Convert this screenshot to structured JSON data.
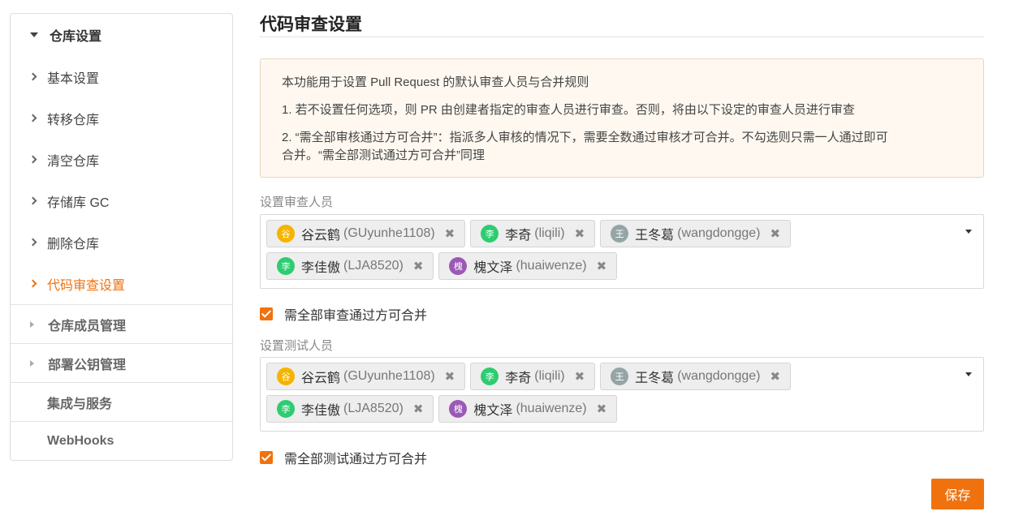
{
  "sidebar": {
    "group_label": "仓库设置",
    "items": [
      {
        "label": "基本设置",
        "active": false
      },
      {
        "label": "转移仓库",
        "active": false
      },
      {
        "label": "清空仓库",
        "active": false
      },
      {
        "label": "存储库 GC",
        "active": false
      },
      {
        "label": "删除仓库",
        "active": false
      },
      {
        "label": "代码审查设置",
        "active": true
      }
    ],
    "sections": [
      {
        "label": "仓库成员管理"
      },
      {
        "label": "部署公钥管理"
      },
      {
        "label": "集成与服务"
      },
      {
        "label": "WebHooks"
      }
    ]
  },
  "page_title": "代码审查设置",
  "notice": {
    "line1": "本功能用于设置 Pull Request 的默认审查人员与合并规则",
    "line2": "1. 若不设置任何选项，则 PR 由创建者指定的审查人员进行审查。否则，将由以下设定的审查人员进行审查",
    "line3a": "2. “需全部审核通过方可合并”：指派多人审核的情况下，需要全数通过审核才可合并。不勾选则只需一人通过即可",
    "line3b": "合并。“需全部测试通过方可合并”同理"
  },
  "reviewers": {
    "label": "设置审查人员",
    "users": [
      {
        "avatar_char": "谷",
        "avatar_color": "#f5b400",
        "name": "谷云鹤",
        "username": "(GUyunhe1108)"
      },
      {
        "avatar_char": "李",
        "avatar_color": "#2ecc71",
        "name": "李奇",
        "username": "(liqili)"
      },
      {
        "avatar_char": "王",
        "avatar_color": "#95a5a6",
        "name": "王冬葛",
        "username": "(wangdongge)"
      },
      {
        "avatar_char": "李",
        "avatar_color": "#2ecc71",
        "name": "李佳傲",
        "username": "(LJA8520)"
      },
      {
        "avatar_char": "槐",
        "avatar_color": "#9b59b6",
        "name": "槐文泽",
        "username": "(huaiwenze)"
      }
    ],
    "checkbox_label": "需全部审查通过方可合并",
    "checked": true
  },
  "testers": {
    "label": "设置测试人员",
    "users": [
      {
        "avatar_char": "谷",
        "avatar_color": "#f5b400",
        "name": "谷云鹤",
        "username": "(GUyunhe1108)"
      },
      {
        "avatar_char": "李",
        "avatar_color": "#2ecc71",
        "name": "李奇",
        "username": "(liqili)"
      },
      {
        "avatar_char": "王",
        "avatar_color": "#95a5a6",
        "name": "王冬葛",
        "username": "(wangdongge)"
      },
      {
        "avatar_char": "李",
        "avatar_color": "#2ecc71",
        "name": "李佳傲",
        "username": "(LJA8520)"
      },
      {
        "avatar_char": "槐",
        "avatar_color": "#9b59b6",
        "name": "槐文泽",
        "username": "(huaiwenze)"
      }
    ],
    "checkbox_label": "需全部测试通过方可合并",
    "checked": true
  },
  "save_label": "保存",
  "remove_glyph": "✖",
  "accent_color": "#f0720f"
}
